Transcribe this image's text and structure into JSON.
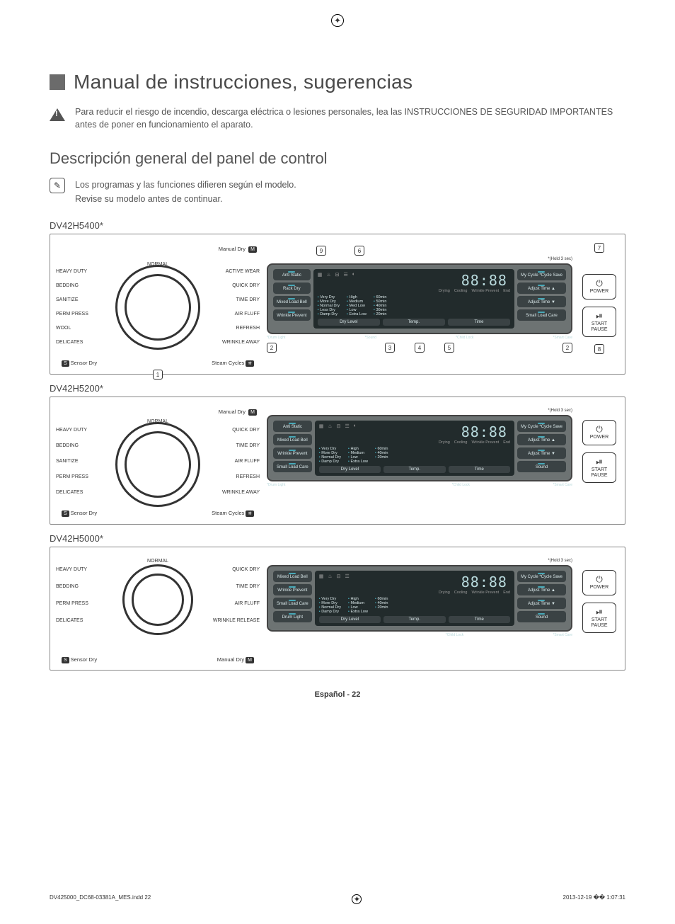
{
  "title": "Manual de instrucciones, sugerencias",
  "warning_text": "Para reducir el riesgo de incendio, descarga eléctrica o lesiones personales, lea las INSTRUCCIONES DE SEGURIDAD IMPORTANTES antes de poner en funcionamiento el aparato.",
  "section_heading": "Descripción general del panel de control",
  "note_line1": "Los programas y las funciones difieren según el modelo.",
  "note_line2": "Revise su modelo antes de continuar.",
  "models": {
    "m1": {
      "name": "DV42H5400*"
    },
    "m2": {
      "name": "DV42H5200*"
    },
    "m3": {
      "name": "DV42H5000*"
    }
  },
  "dial_labels_m1": {
    "top": "Manual Dry",
    "left": [
      "HEAVY DUTY",
      "BEDDING",
      "SANITIZE",
      "PERM PRESS",
      "WOOL",
      "DELICATES"
    ],
    "center_top": "NORMAL",
    "right": [
      "ACTIVE WEAR",
      "QUICK DRY",
      "TIME DRY",
      "AIR FLUFF",
      "REFRESH",
      "WRINKLE AWAY"
    ],
    "bottom_left": "Sensor Dry",
    "bottom_right": "Steam Cycles"
  },
  "dial_labels_m2": {
    "top": "Manual Dry",
    "left": [
      "HEAVY DUTY",
      "BEDDING",
      "SANITIZE",
      "PERM PRESS",
      "DELICATES"
    ],
    "center_top": "NORMAL",
    "right": [
      "QUICK DRY",
      "TIME DRY",
      "AIR FLUFF",
      "REFRESH",
      "WRINKLE AWAY"
    ],
    "bottom_left": "Sensor Dry",
    "bottom_right": "Steam Cycles"
  },
  "dial_labels_m3": {
    "left": [
      "HEAVY DUTY",
      "BEDDING",
      "PERM PRESS",
      "DELICATES"
    ],
    "center_top": "NORMAL",
    "right": [
      "QUICK DRY",
      "TIME DRY",
      "AIR FLUFF",
      "WRINKLE RELEASE"
    ],
    "bottom_left": "Sensor Dry",
    "bottom_right": "Manual Dry"
  },
  "lcd_m1": {
    "hold_label": "*(Hold 3 sec)",
    "left_buttons": [
      "Anti Static",
      "Rack Dry",
      "Mixed Load Bell",
      "Wrinkle Prevent"
    ],
    "time": "88:88",
    "status": [
      "Drying",
      "Cooling",
      "Wrinkle Prevent",
      "End"
    ],
    "dry_levels": [
      "Very Dry",
      "More Dry",
      "Normal Dry",
      "Less Dry",
      "Damp Dry"
    ],
    "temps": [
      "High",
      "Medium",
      "Med Low",
      "Low",
      "Extra Low"
    ],
    "times": [
      "60min",
      "50min",
      "40min",
      "30min",
      "20min"
    ],
    "tabs": [
      "Dry Level",
      "Temp.",
      "Time"
    ],
    "right_buttons": [
      "My Cycle *Cycle Save",
      "Adjust Time ▲",
      "Adjust Time ▼",
      "Small Load Care"
    ],
    "foot_left": "*Drum Light",
    "foot_mid_l": "*Sound",
    "foot_mid_r": "*Child Lock",
    "foot_right": "*Smart Care"
  },
  "lcd_m2": {
    "hold_label": "*(Hold 3 sec)",
    "left_buttons": [
      "Anti Static",
      "Mixed Load Bell",
      "Wrinkle Prevent",
      "Small Load Care"
    ],
    "time": "88:88",
    "status": [
      "Drying",
      "Cooling",
      "Wrinkle Prevent",
      "End"
    ],
    "dry_levels": [
      "Very Dry",
      "More Dry",
      "Normal Dry",
      "Damp Dry"
    ],
    "temps": [
      "High",
      "Medium",
      "Low",
      "Extra Low"
    ],
    "times": [
      "60min",
      "40min",
      "20min"
    ],
    "tabs": [
      "Dry Level",
      "Temp.",
      "Time"
    ],
    "right_buttons": [
      "My Cycle *Cycle Save",
      "Adjust Time ▲",
      "Adjust Time ▼",
      "Sound"
    ],
    "foot_left": "*Drum Light",
    "foot_mid_r": "*Child Lock",
    "foot_right": "*Smart Care"
  },
  "lcd_m3": {
    "hold_label": "*(Hold 3 sec)",
    "left_buttons": [
      "Mixed Load Bell",
      "Wrinkle Prevent",
      "Small Load Care",
      "Drum Light"
    ],
    "time": "88:88",
    "status": [
      "Drying",
      "Cooling",
      "Wrinkle Prevent",
      "End"
    ],
    "dry_levels": [
      "Very Dry",
      "More Dry",
      "Normal Dry",
      "Damp Dry"
    ],
    "temps": [
      "High",
      "Medium",
      "Low",
      "Extra Low"
    ],
    "times": [
      "60min",
      "40min",
      "20min"
    ],
    "tabs": [
      "Dry Level",
      "Temp.",
      "Time"
    ],
    "right_buttons": [
      "My Cycle *Cycle Save",
      "Adjust Time ▲",
      "Adjust Time ▼",
      "Sound"
    ],
    "foot_mid_r": "*Child Lock",
    "foot_right": "*Smart Care"
  },
  "side_buttons": {
    "power": "POWER",
    "start": "START",
    "pause": "PAUSE"
  },
  "callouts": [
    "1",
    "2",
    "3",
    "4",
    "5",
    "6",
    "7",
    "8",
    "9"
  ],
  "footer": "Español - 22",
  "print_file": "DV425000_DC68-03381A_MES.indd   22",
  "print_time": "2013-12-19   �� 1:07:31"
}
